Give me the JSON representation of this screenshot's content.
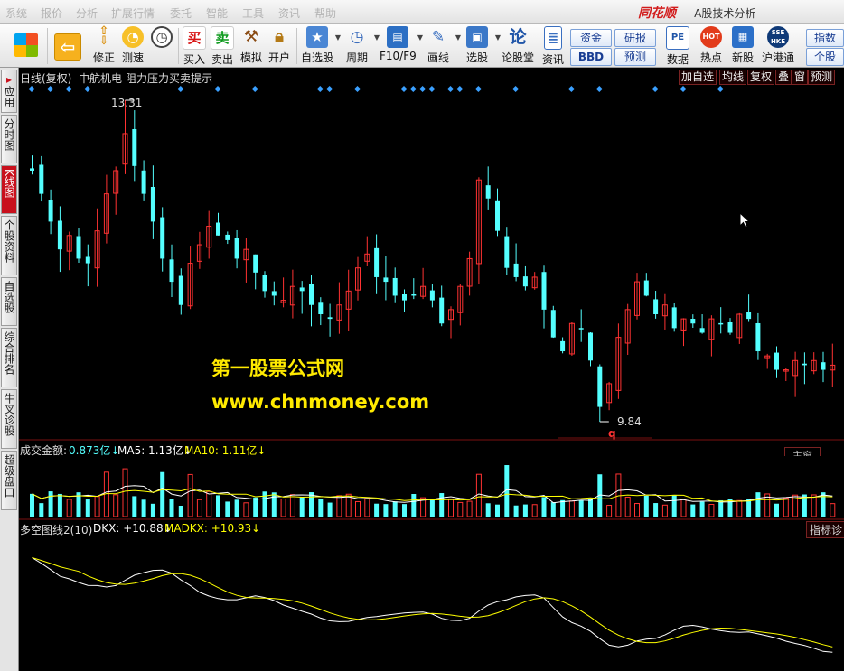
{
  "menu": [
    "系统",
    "报价",
    "分析",
    "扩展行情",
    "委托",
    "智能",
    "工具",
    "资讯",
    "帮助"
  ],
  "brand": "同花顺",
  "window_title": "- A股技术分析",
  "toolbar": {
    "edit": "修正",
    "speed": "测速",
    "buy": "买入",
    "sell": "卖出",
    "simulate": "模拟",
    "open": "开户",
    "watchlist": "自选股",
    "period": "周期",
    "f10": "F10/F9",
    "draw": "画线",
    "stockpick": "选股",
    "forum": "论股堂",
    "news": "资讯",
    "funds": "资金",
    "bbd": "BBD",
    "research": "研报",
    "forecast": "预测",
    "data": "数据",
    "hotspot": "热点",
    "newstock": "新股",
    "hkconnect": "沪港通",
    "index": "指数",
    "single": "个股",
    "buy_glyph": "买",
    "sell_glyph": "卖",
    "forum_glyph": "论",
    "pe_glyph": "PE",
    "hot_glyph": "HOT",
    "hk_glyph": "SSE HKE"
  },
  "side_tabs": [
    "应用",
    "分时图",
    "K线图",
    "个股资料",
    "自选股",
    "综合排名",
    "牛叉诊股",
    "超级盘口"
  ],
  "chart": {
    "header_left": "日线(复权)",
    "stock_name": "中航机电",
    "indicator_name": "阻力压力买卖提示",
    "right_buttons": [
      "加自选",
      "均线",
      "复权",
      "叠",
      "窗",
      "预测"
    ],
    "high_label": "13.31",
    "low_label": "9.84",
    "q_marker": "q"
  },
  "volume": {
    "label": "成交金额:",
    "value": "0.873亿↓",
    "ma5": "MA5: 1.13亿↓",
    "ma10": "MA10: 1.11亿↓",
    "tag": "主窗"
  },
  "indicator": {
    "name": "多空图线2(10)",
    "dkx": "DKX: +10.88↓",
    "madkx": "MADKX: +10.93↓",
    "tag": "指标诊"
  },
  "watermark": {
    "line1": "第一股票公式网",
    "line2": "www.chnmoney.com"
  },
  "colors": {
    "up": "#ff3232",
    "down": "#54ffff",
    "line_white": "#ffffff",
    "line_yellow": "#ffff00",
    "signal": "#3aa0ff"
  },
  "chart_data": {
    "type": "candlestick",
    "marked_high": 13.31,
    "marked_low": 9.84,
    "closes": [
      12.55,
      12.3,
      12.0,
      11.7,
      11.85,
      11.6,
      11.55,
      11.9,
      12.3,
      12.55,
      12.95,
      12.6,
      12.3,
      12.0,
      11.6,
      11.35,
      11.1,
      11.55,
      11.75,
      11.95,
      11.85,
      11.8,
      11.6,
      11.7,
      11.45,
      11.25,
      11.2,
      11.15,
      11.3,
      11.25,
      11.1,
      11.0,
      10.95,
      11.1,
      11.25,
      11.5,
      11.65,
      11.4,
      11.35,
      11.2,
      11.15,
      11.2,
      11.3,
      11.15,
      10.9,
      11.05,
      11.3,
      11.6,
      12.45,
      12.25,
      11.9,
      11.5,
      11.4,
      11.3,
      11.4,
      11.05,
      10.75,
      10.6,
      10.9,
      10.85,
      10.5,
      10.0,
      10.25,
      10.75,
      11.05,
      11.35,
      11.2,
      11.0,
      11.1,
      10.85,
      10.95,
      10.9,
      10.8,
      10.95,
      10.9,
      10.8,
      11.0,
      10.95,
      10.6,
      10.55,
      10.4,
      10.4,
      10.5,
      10.45,
      10.5,
      10.4,
      10.45
    ]
  }
}
